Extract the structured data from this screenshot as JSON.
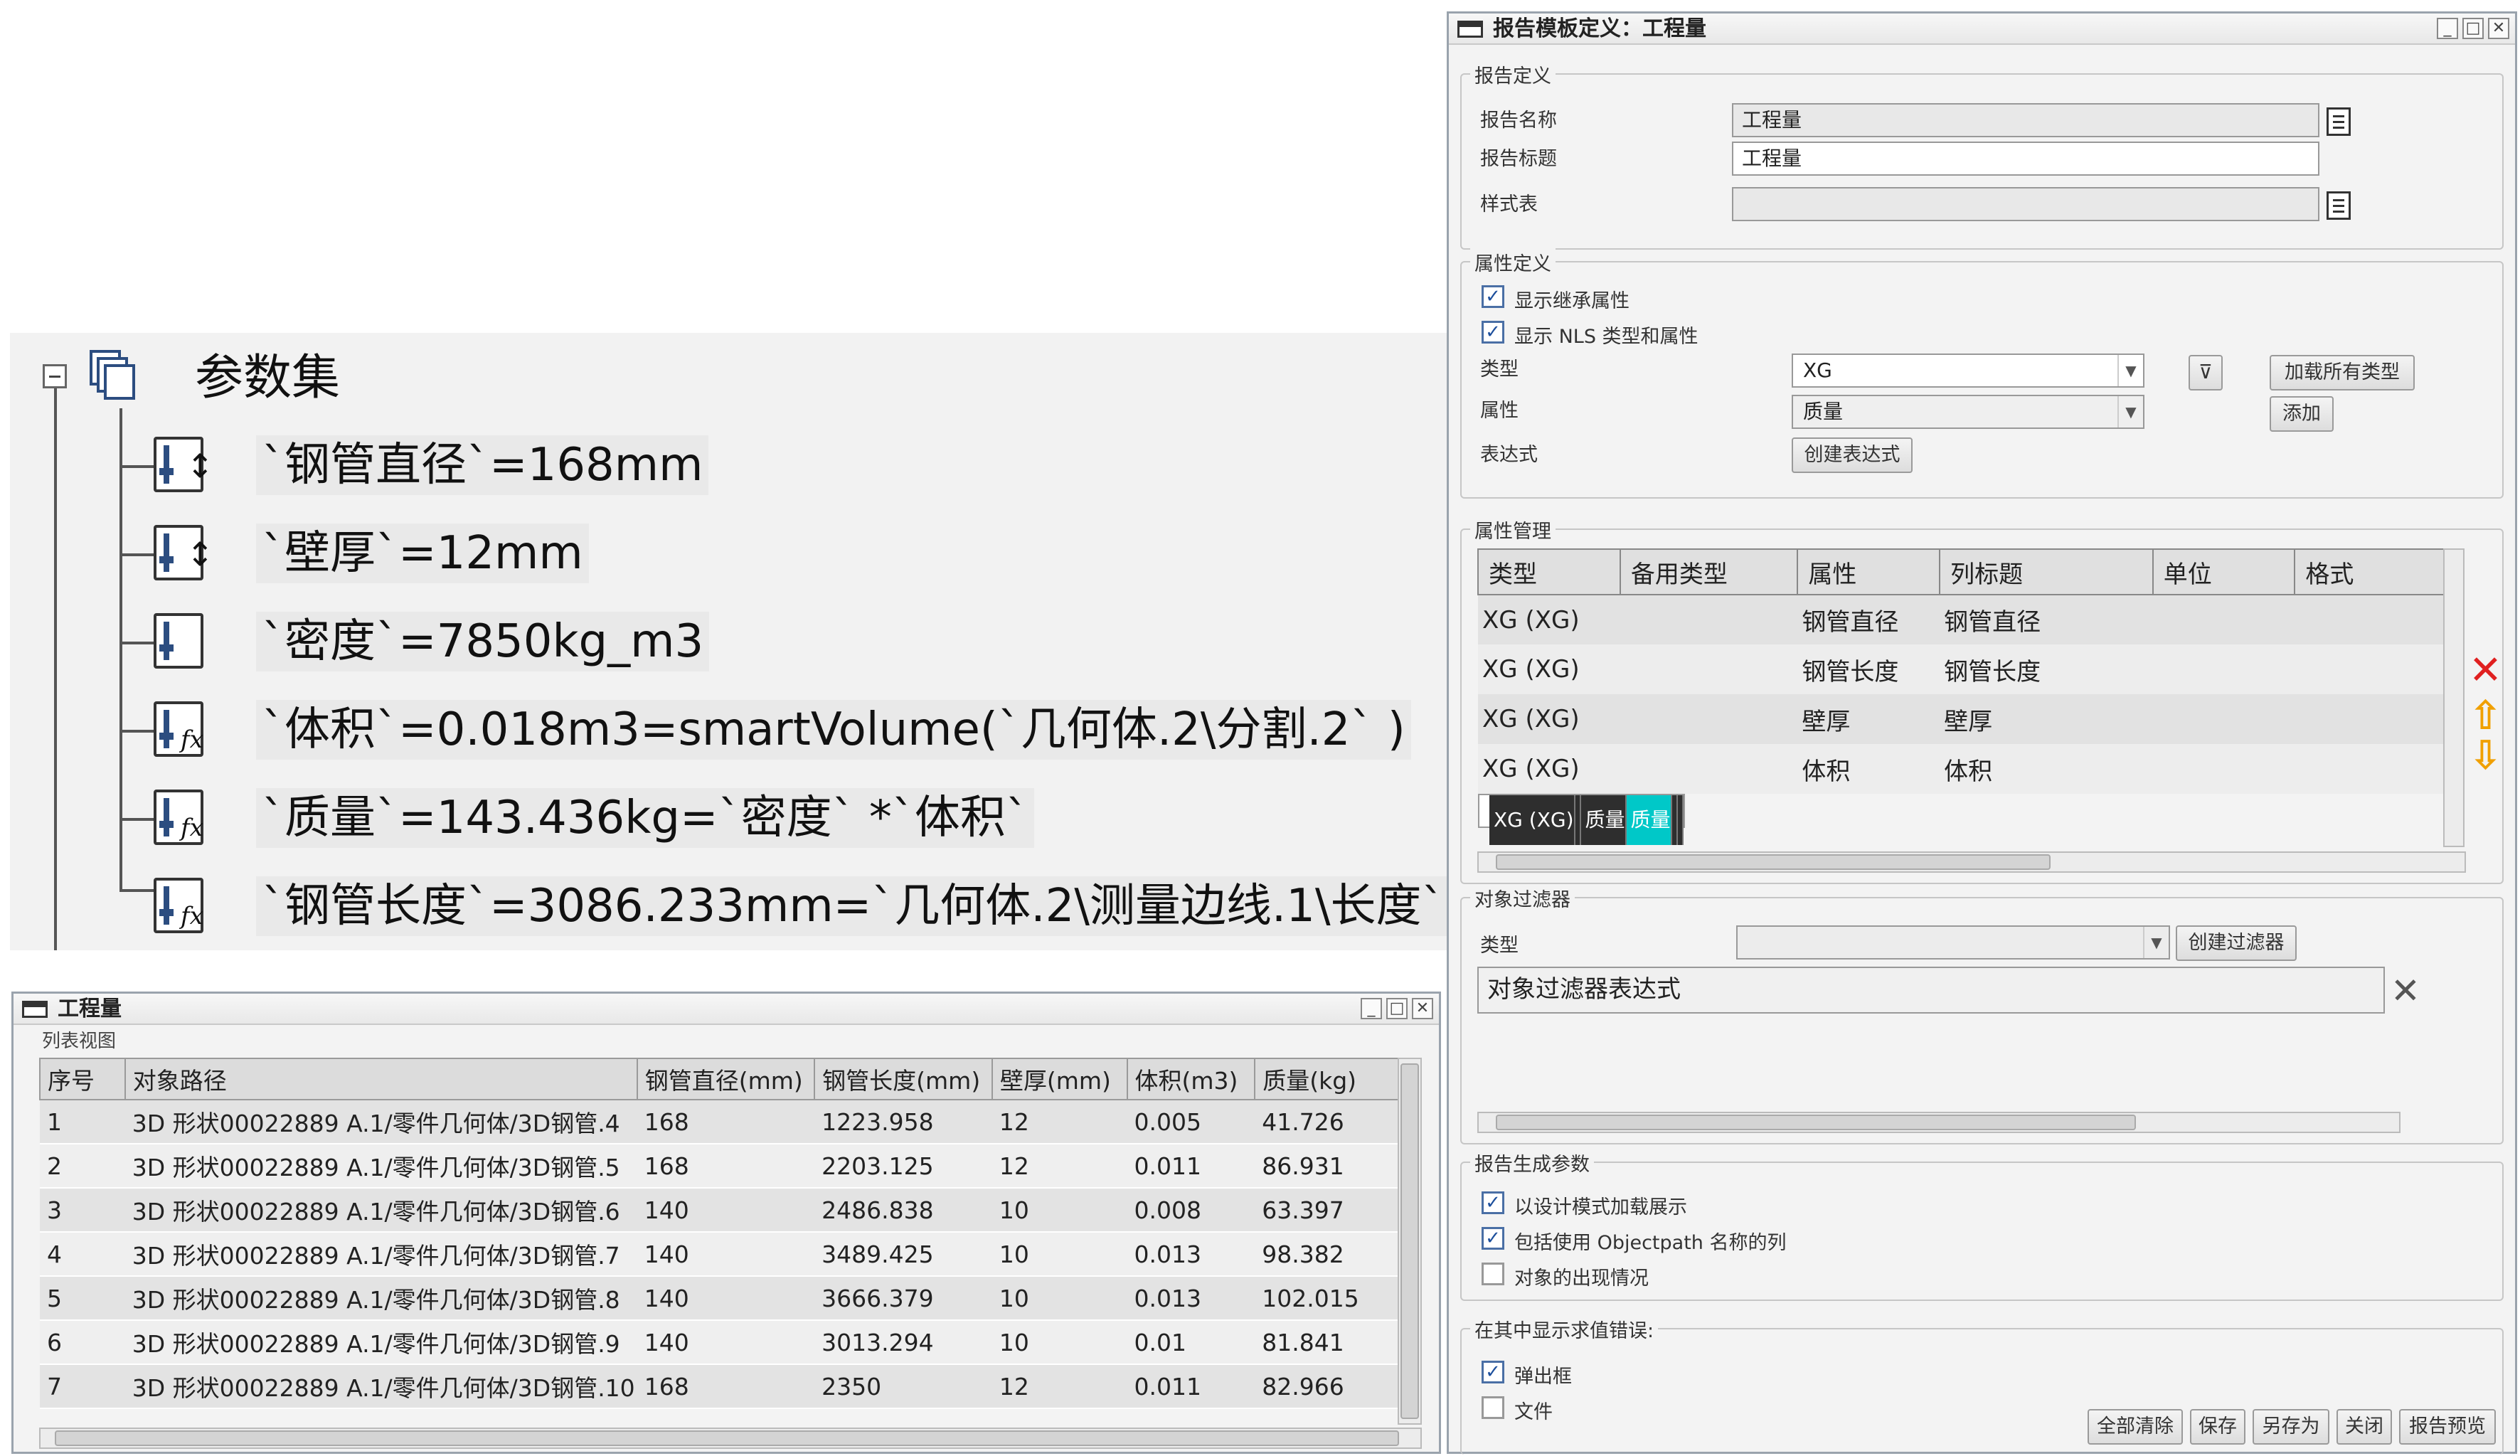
{
  "tree": {
    "root": "参数集",
    "items": [
      {
        "text": "`钢管直径`=168mm",
        "icon": "length-parameter-icon"
      },
      {
        "text": "`壁厚`=12mm",
        "icon": "length-parameter-icon"
      },
      {
        "text": "`密度`=7850kg_m3",
        "icon": "real-parameter-icon"
      },
      {
        "text": "`体积`=0.018m3=smartVolume(`几何体.2\\分割.2` )",
        "icon": "formula-parameter-icon"
      },
      {
        "text": "`质量`=143.436kg=`密度` *`体积`",
        "icon": "formula-parameter-icon"
      },
      {
        "text": "`钢管长度`=3086.233mm=`几何体.2\\测量边线.1\\长度`",
        "icon": "formula-parameter-icon"
      }
    ]
  },
  "result_window": {
    "title": "工程量",
    "subtitle": "列表视图",
    "columns": [
      "序号",
      "对象路径",
      "钢管直径(mm)",
      "钢管长度(mm)",
      "壁厚(mm)",
      "体积(m3)",
      "质量(kg)"
    ],
    "rows": [
      [
        "1",
        "3D 形状00022889 A.1/零件几何体/3D钢管.4",
        "168",
        "1223.958",
        "12",
        "0.005",
        "41.726"
      ],
      [
        "2",
        "3D 形状00022889 A.1/零件几何体/3D钢管.5",
        "168",
        "2203.125",
        "12",
        "0.011",
        "86.931"
      ],
      [
        "3",
        "3D 形状00022889 A.1/零件几何体/3D钢管.6",
        "140",
        "2486.838",
        "10",
        "0.008",
        "63.397"
      ],
      [
        "4",
        "3D 形状00022889 A.1/零件几何体/3D钢管.7",
        "140",
        "3489.425",
        "10",
        "0.013",
        "98.382"
      ],
      [
        "5",
        "3D 形状00022889 A.1/零件几何体/3D钢管.8",
        "140",
        "3666.379",
        "10",
        "0.013",
        "102.015"
      ],
      [
        "6",
        "3D 形状00022889 A.1/零件几何体/3D钢管.9",
        "140",
        "3013.294",
        "10",
        "0.01",
        "81.841"
      ],
      [
        "7",
        "3D 形状00022889 A.1/零件几何体/3D钢管.10",
        "168",
        "2350",
        "12",
        "0.011",
        "82.966"
      ]
    ]
  },
  "dialog": {
    "title": "报告模板定义：工程量",
    "report_def": {
      "group": "报告定义",
      "name_label": "报告名称",
      "name_value": "工程量",
      "title_label": "报告标题",
      "title_value": "工程量",
      "style_label": "样式表",
      "style_value": ""
    },
    "attr_def": {
      "group": "属性定义",
      "show_inherited": "显示继承属性",
      "show_nls": "显示 NLS 类型和属性",
      "type_label": "类型",
      "type_value": "XG",
      "attr_label": "属性",
      "attr_value": "质量",
      "expr_label": "表达式",
      "create_expr_btn": "创建表达式",
      "load_all_btn": "加载所有类型",
      "add_btn": "添加"
    },
    "attr_mgmt": {
      "group": "属性管理",
      "columns": [
        "类型",
        "备用类型",
        "属性",
        "列标题",
        "单位",
        "格式"
      ],
      "rows": [
        [
          "XG (XG)",
          "",
          "钢管直径",
          "钢管直径",
          "",
          ""
        ],
        [
          "XG (XG)",
          "",
          "钢管长度",
          "钢管长度",
          "",
          ""
        ],
        [
          "XG (XG)",
          "",
          "壁厚",
          "壁厚",
          "",
          ""
        ],
        [
          "XG (XG)",
          "",
          "体积",
          "体积",
          "",
          ""
        ],
        [
          "XG (XG)",
          "",
          "质量",
          "质量",
          "",
          ""
        ]
      ]
    },
    "filter": {
      "group": "对象过滤器",
      "type_label": "类型",
      "create_filter_btn": "创建过滤器",
      "expr_value": "对象过滤器表达式"
    },
    "gen_params": {
      "group": "报告生成参数",
      "opt1": "以设计模式加载展示",
      "opt2": "包括使用 Objectpath 名称的列",
      "opt3": "对象的出现情况"
    },
    "error_display": {
      "group": "在其中显示求值错误:",
      "popup": "弹出框",
      "file": "文件"
    },
    "footer_buttons": [
      "全部清除",
      "保存",
      "另存为",
      "关闭",
      "报告预览"
    ],
    "colors": {
      "selected_row": "#2e2e2e",
      "highlight_cell": "#00c8c8",
      "delete_icon": "#e02020",
      "arrow_icon": "#f0a000"
    }
  }
}
